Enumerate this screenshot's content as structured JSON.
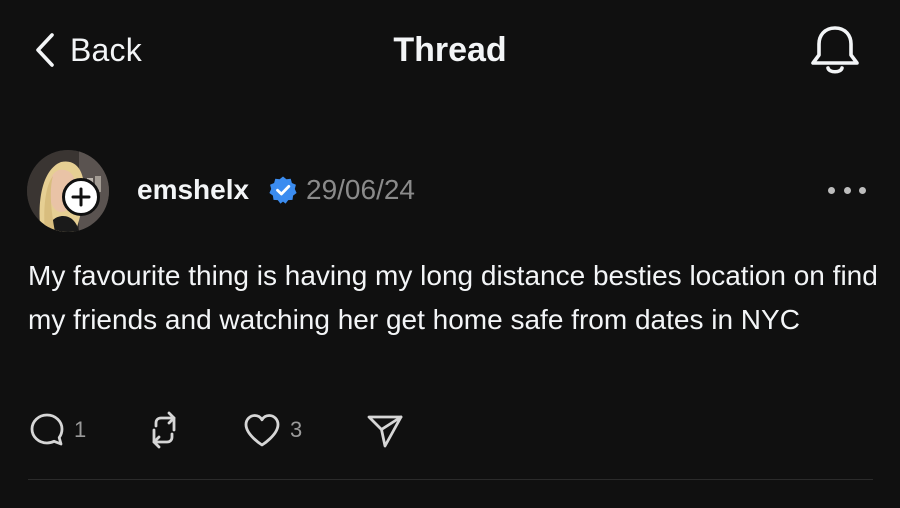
{
  "header": {
    "back_label": "Back",
    "title": "Thread",
    "notifications_icon": "bell-icon"
  },
  "post": {
    "author": {
      "username": "emshelx",
      "verified": true,
      "verified_color": "#3b8cf0",
      "avatar": "avatar-photo"
    },
    "date": "29/06/24",
    "text": "My favourite thing is having my long distance besties location on find my friends and watching her get home safe from dates in NYC",
    "actions": {
      "reply_count": "1",
      "repost_count": "",
      "like_count": "3"
    }
  },
  "colors": {
    "background": "#101010",
    "text_primary": "#f3f5f7",
    "text_secondary": "#8a8a8a",
    "verified_blue": "#3b8cf0"
  }
}
